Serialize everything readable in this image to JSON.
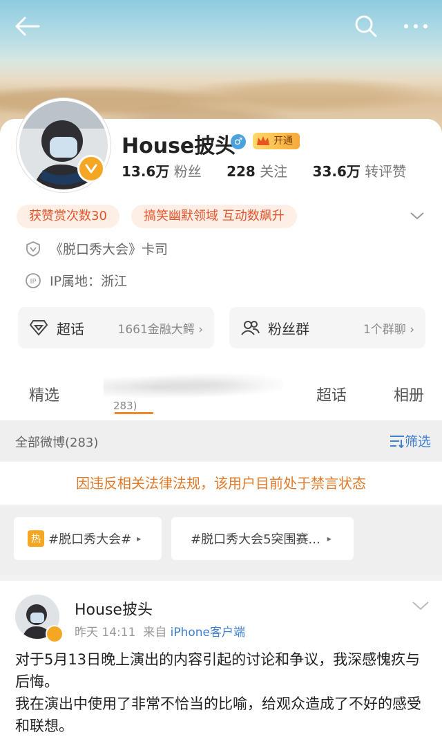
{
  "topbar": {
    "back_icon": "back-arrow-icon",
    "search_icon": "search-icon",
    "more_icon": "more-icon"
  },
  "profile": {
    "username": "House披头",
    "vip_label": "开通",
    "stats": [
      {
        "value": "13.6万",
        "label": "粉丝"
      },
      {
        "value": "228",
        "label": "关注"
      },
      {
        "value": "33.6万",
        "label": "转评赞"
      }
    ],
    "chips": [
      "获赞赏次数30",
      "搞笑幽默领域 互动数飙升"
    ],
    "verification": "《脱口秀大会》卡司",
    "ip_location": "IP属地：浙江",
    "supertopic": {
      "title": "超话",
      "sub": "1661金融大鳄"
    },
    "fangroup": {
      "title": "粉丝群",
      "sub": "1个群聊"
    }
  },
  "tabs": {
    "featured": "精选",
    "weibo_count": "283)",
    "supertopic": "超话",
    "album": "相册"
  },
  "filter": {
    "all": "全部微博(283)",
    "filter_label": "筛选"
  },
  "notice": "因违反相关法律法规，该用户目前处于禁言状态",
  "topics": [
    {
      "badge": "热",
      "label": "#脱口秀大会#"
    },
    {
      "label": "#脱口秀大会5突围赛..."
    }
  ],
  "post": {
    "author": "House披头",
    "time": "昨天 14:11",
    "from_prefix": "来自",
    "source": "iPhone客户端",
    "text_1": "对于5月13日晚上演出的内容引起的讨论和争议，我深感愧疚与后悔。",
    "text_2": "我在演出中使用了非常不恰当的比喻，给观众造成了不好的感受和联想。"
  },
  "colors": {
    "accent_orange": "#f08a28",
    "link_blue": "#3f7fd0",
    "chip_red": "#e2552b"
  }
}
